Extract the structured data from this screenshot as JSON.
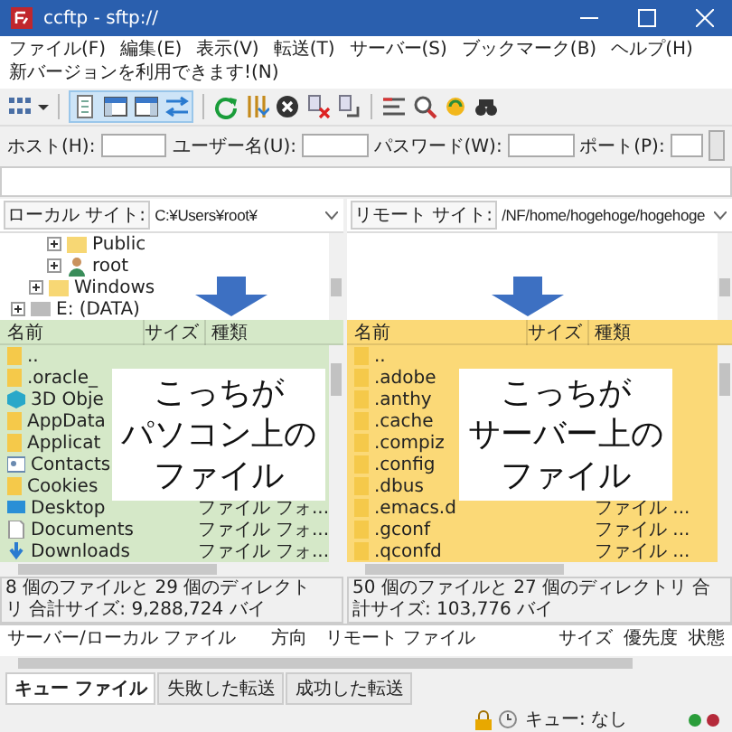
{
  "window": {
    "title": "ccftp - sftp://"
  },
  "menu": [
    "ファイル(F)",
    "編集(E)",
    "表示(V)",
    "転送(T)",
    "サーバー(S)",
    "ブックマーク(B)",
    "ヘルプ(H)",
    "新バージョンを利用できます!(N)"
  ],
  "quickconnect": [
    {
      "label": "ホスト(H):",
      "kind": "wide"
    },
    {
      "label": "ユーザー名(U):",
      "kind": "wide"
    },
    {
      "label": "パスワード(W):",
      "kind": "wide"
    },
    {
      "label": "ポート(P):",
      "kind": "short"
    }
  ],
  "local": {
    "site_label": "ローカル サイト:",
    "path": "C:¥Users¥root¥",
    "tree": [
      {
        "children": [
          {
            "children": [
              {
                "label": "Public",
                "kind": "folder",
                "expanded": false
              },
              {
                "label": "root",
                "kind": "user",
                "expanded": false
              }
            ]
          },
          {
            "label": "Windows",
            "kind": "folder",
            "expanded": false
          }
        ]
      },
      {
        "label": "E: (DATA)",
        "kind": "drive",
        "expanded": false
      }
    ],
    "columns": [
      "名前",
      "サイズ",
      "種類"
    ],
    "files": [
      {
        "name": "..",
        "kind": "folder"
      },
      {
        "name": ".oracle_",
        "kind": "folder"
      },
      {
        "name": "3D Obje",
        "kind": "cube"
      },
      {
        "name": "AppData",
        "kind": "folder"
      },
      {
        "name": "Applicat",
        "kind": "folder"
      },
      {
        "name": "Contacts",
        "kind": "contacts"
      },
      {
        "name": "Cookies",
        "kind": "folder"
      },
      {
        "name": "Desktop",
        "kind": "desktop",
        "type": "ファイル フォ..."
      },
      {
        "name": "Documents",
        "kind": "document",
        "type": "ファイル フォ..."
      },
      {
        "name": "Downloads",
        "kind": "download",
        "type": "ファイル フォ..."
      }
    ],
    "callout": [
      "こっちが",
      "パソコン上の",
      "ファイル"
    ],
    "status": "8 個のファイルと 29 個のディレクトリ 合計サイズ: 9,288,724 バイ"
  },
  "remote": {
    "site_label": "リモート サイト:",
    "path": "/NF/home/hogehoge/hogehoge",
    "columns": [
      "名前",
      "サイズ",
      "種類"
    ],
    "files": [
      {
        "name": "..",
        "kind": "folder"
      },
      {
        "name": ".adobe",
        "kind": "folder"
      },
      {
        "name": ".anthy",
        "kind": "folder"
      },
      {
        "name": ".cache",
        "kind": "folder"
      },
      {
        "name": ".compiz",
        "kind": "folder"
      },
      {
        "name": ".config",
        "kind": "folder"
      },
      {
        "name": ".dbus",
        "kind": "folder"
      },
      {
        "name": ".emacs.d",
        "kind": "folder",
        "type": "ファイル ..."
      },
      {
        "name": ".gconf",
        "kind": "folder",
        "type": "ファイル ..."
      },
      {
        "name": ".qconfd",
        "kind": "folder",
        "type": "ファイル ..."
      }
    ],
    "callout": [
      "こっちが",
      "サーバー上の",
      "ファイル"
    ],
    "status": "50 個のファイルと 27 個のディレクトリ 合計サイズ: 103,776 バイ"
  },
  "queue": {
    "columns": [
      "サーバー/ローカル ファイル",
      "方向",
      "リモート ファイル",
      "サイズ",
      "優先度",
      "状態"
    ]
  },
  "queue_tabs": [
    {
      "label": "キュー ファイル",
      "selected": true
    },
    {
      "label": "失敗した転送",
      "selected": false
    },
    {
      "label": "成功した転送",
      "selected": false
    }
  ],
  "status_bar": {
    "queue": "キュー: なし"
  }
}
